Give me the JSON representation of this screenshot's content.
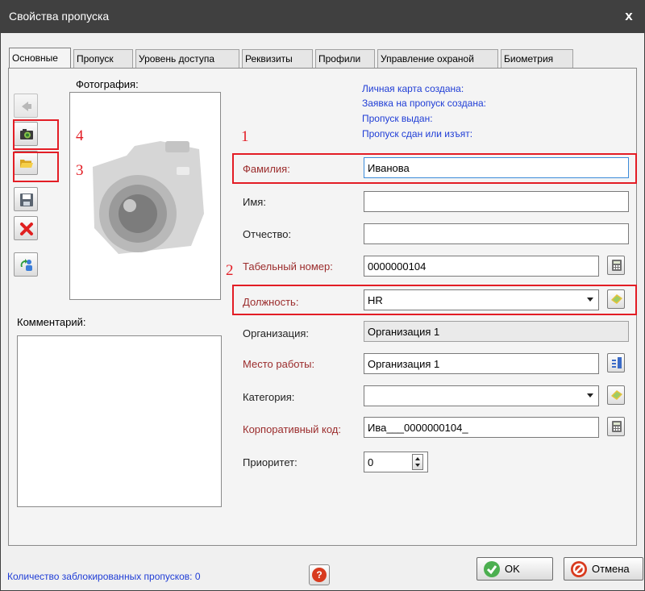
{
  "window": {
    "title": "Свойства пропуска",
    "close_glyph": "x"
  },
  "tabs": [
    {
      "label": "Основные",
      "active": true
    },
    {
      "label": "Пропуск"
    },
    {
      "label": "Уровень доступа"
    },
    {
      "label": "Реквизиты"
    },
    {
      "label": "Профили"
    },
    {
      "label": "Управление охраной"
    },
    {
      "label": "Биометрия"
    }
  ],
  "photo": {
    "label": "Фотография:"
  },
  "comment": {
    "label": "Комментарий:",
    "value": ""
  },
  "toolbar_icons": [
    "back-arrow-icon",
    "camera-icon",
    "folder-open-icon",
    "save-disk-icon",
    "delete-x-icon",
    "swap-users-icon"
  ],
  "info_lines": [
    "Личная карта создана:",
    "Заявка на пропуск создана:",
    "Пропуск выдан:",
    "Пропуск сдан или изъят:"
  ],
  "fields": {
    "surname": {
      "label": "Фамилия:",
      "value": "Иванова"
    },
    "name": {
      "label": "Имя:",
      "value": ""
    },
    "patronymic": {
      "label": "Отчество:",
      "value": ""
    },
    "personnel_number": {
      "label": "Табельный номер:",
      "value": "0000000104"
    },
    "position": {
      "label": "Должность:",
      "value": "HR"
    },
    "organization": {
      "label": "Организация:",
      "value": "Организация 1"
    },
    "workplace": {
      "label": "Место работы:",
      "value": "Организация 1"
    },
    "category": {
      "label": "Категория:",
      "value": ""
    },
    "corporate_code": {
      "label": "Корпоративный код:",
      "value": "Ива___0000000104_"
    },
    "priority": {
      "label": "Приоритет:",
      "value": "0"
    }
  },
  "annotations": {
    "n1": "1",
    "n2": "2",
    "n3": "3",
    "n4": "4",
    "color": "#e31d25"
  },
  "footer": {
    "blocked_label": "Количество заблокированных пропусков: 0",
    "ok_label": "OK",
    "cancel_label": "Отмена"
  },
  "colors": {
    "titlebar": "#404040",
    "info_text": "#1f3dd6",
    "required_label": "#9b2c2c",
    "highlight": "#e31d25"
  }
}
